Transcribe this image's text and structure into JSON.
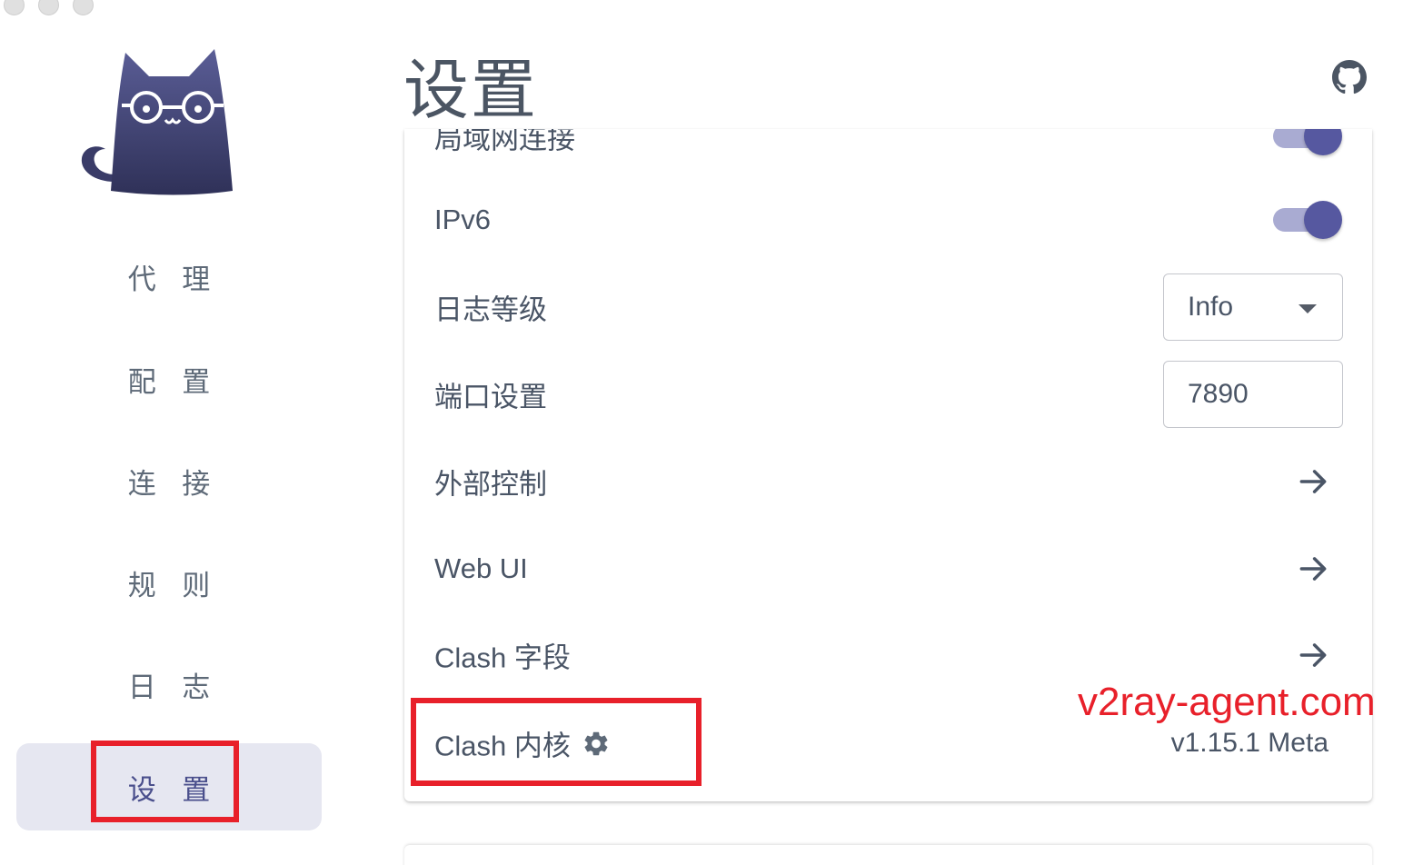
{
  "header": {
    "title": "设置",
    "github_icon": "github-icon"
  },
  "sidebar": {
    "logo_icon": "cat-logo-icon",
    "items": [
      {
        "label": "代 理",
        "active": false
      },
      {
        "label": "配 置",
        "active": false
      },
      {
        "label": "连 接",
        "active": false
      },
      {
        "label": "规 则",
        "active": false
      },
      {
        "label": "日 志",
        "active": false
      },
      {
        "label": "设 置",
        "active": true
      }
    ]
  },
  "settings": {
    "lan": {
      "label": "局域网连接",
      "enabled": true
    },
    "ipv6": {
      "label": "IPv6",
      "enabled": true
    },
    "log_level": {
      "label": "日志等级",
      "value": "Info"
    },
    "port": {
      "label": "端口设置",
      "value": "7890"
    },
    "external_control": {
      "label": "外部控制"
    },
    "web_ui": {
      "label": "Web UI"
    },
    "clash_fields": {
      "label": "Clash 字段"
    },
    "clash_core": {
      "label": "Clash 内核",
      "version": "v1.15.1 Meta"
    }
  },
  "watermark": "v2ray-agent.com",
  "colors": {
    "accent": "#5658a0",
    "accent_track": "#a9abd2",
    "sidebar_active_bg": "#e6e7f1",
    "annotation_red": "#e8202a",
    "text": "#4a5566"
  }
}
